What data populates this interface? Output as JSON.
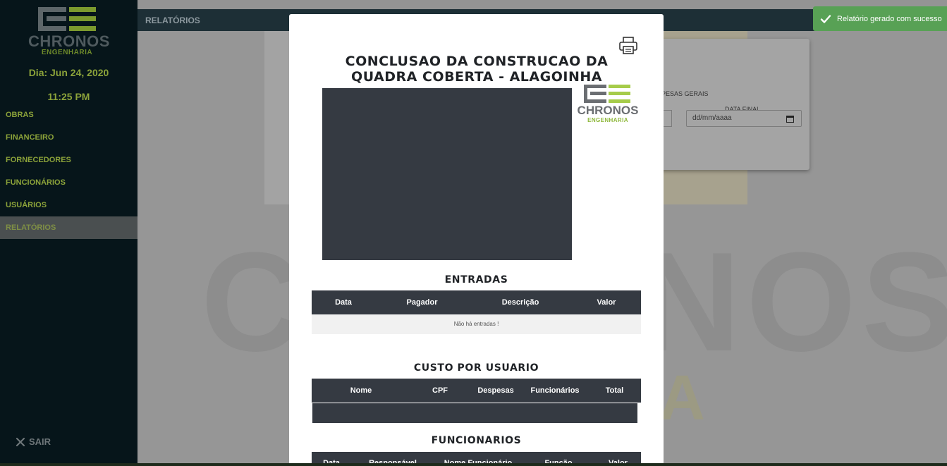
{
  "sidebar": {
    "logo_brand": "CHRONOS",
    "logo_sub": "ENGENHARIA",
    "date": "Dia: Jun 24, 2020",
    "time": "11:25 PM",
    "items": [
      {
        "label": "OBRAS"
      },
      {
        "label": "FINANCEIRO"
      },
      {
        "label": "FORNECEDORES"
      },
      {
        "label": "FUNCIONÁRIOS"
      },
      {
        "label": "USUÁRIOS"
      },
      {
        "label": "RELATÓRIOS",
        "active": true
      }
    ],
    "logout_label": "SAIR"
  },
  "topbar": {
    "title": "RELATÓRIOS"
  },
  "background": {
    "watermark": "CHRONOS",
    "watermark_sub": "A",
    "card": {
      "despesas_label": "PESAS GERAIS",
      "data_final_label": "DATA FINAL",
      "date_placeholder": "dd/mm/aaaa"
    }
  },
  "modal": {
    "title_line1": "CONCLUSAO DA CONSTRUCAO DA",
    "title_line2": "QUADRA COBERTA - ALAGOINHA",
    "logo_brand": "CHRONOS",
    "logo_sub": "ENGENHARIA",
    "entradas": {
      "title": "ENTRADAS",
      "columns": [
        "Data",
        "Pagador",
        "Descrição",
        "Valor"
      ],
      "empty_message": "Não há entradas !"
    },
    "custo": {
      "title": "CUSTO POR USUARIO",
      "columns": [
        "Nome",
        "CPF",
        "Despesas",
        "Funcionários",
        "Total"
      ]
    },
    "funcionarios": {
      "title": "FUNCIONARIOS",
      "columns": [
        "Data",
        "Responsável",
        "Nome Funcionário",
        "Função",
        "Valor"
      ]
    }
  },
  "toast": {
    "message": "Relatório gerado com sucesso"
  },
  "colors": {
    "sidebar_bg": "#06151a",
    "accent_green": "#8ca33a",
    "table_header": "#353a42",
    "toast_green": "#58a155"
  }
}
